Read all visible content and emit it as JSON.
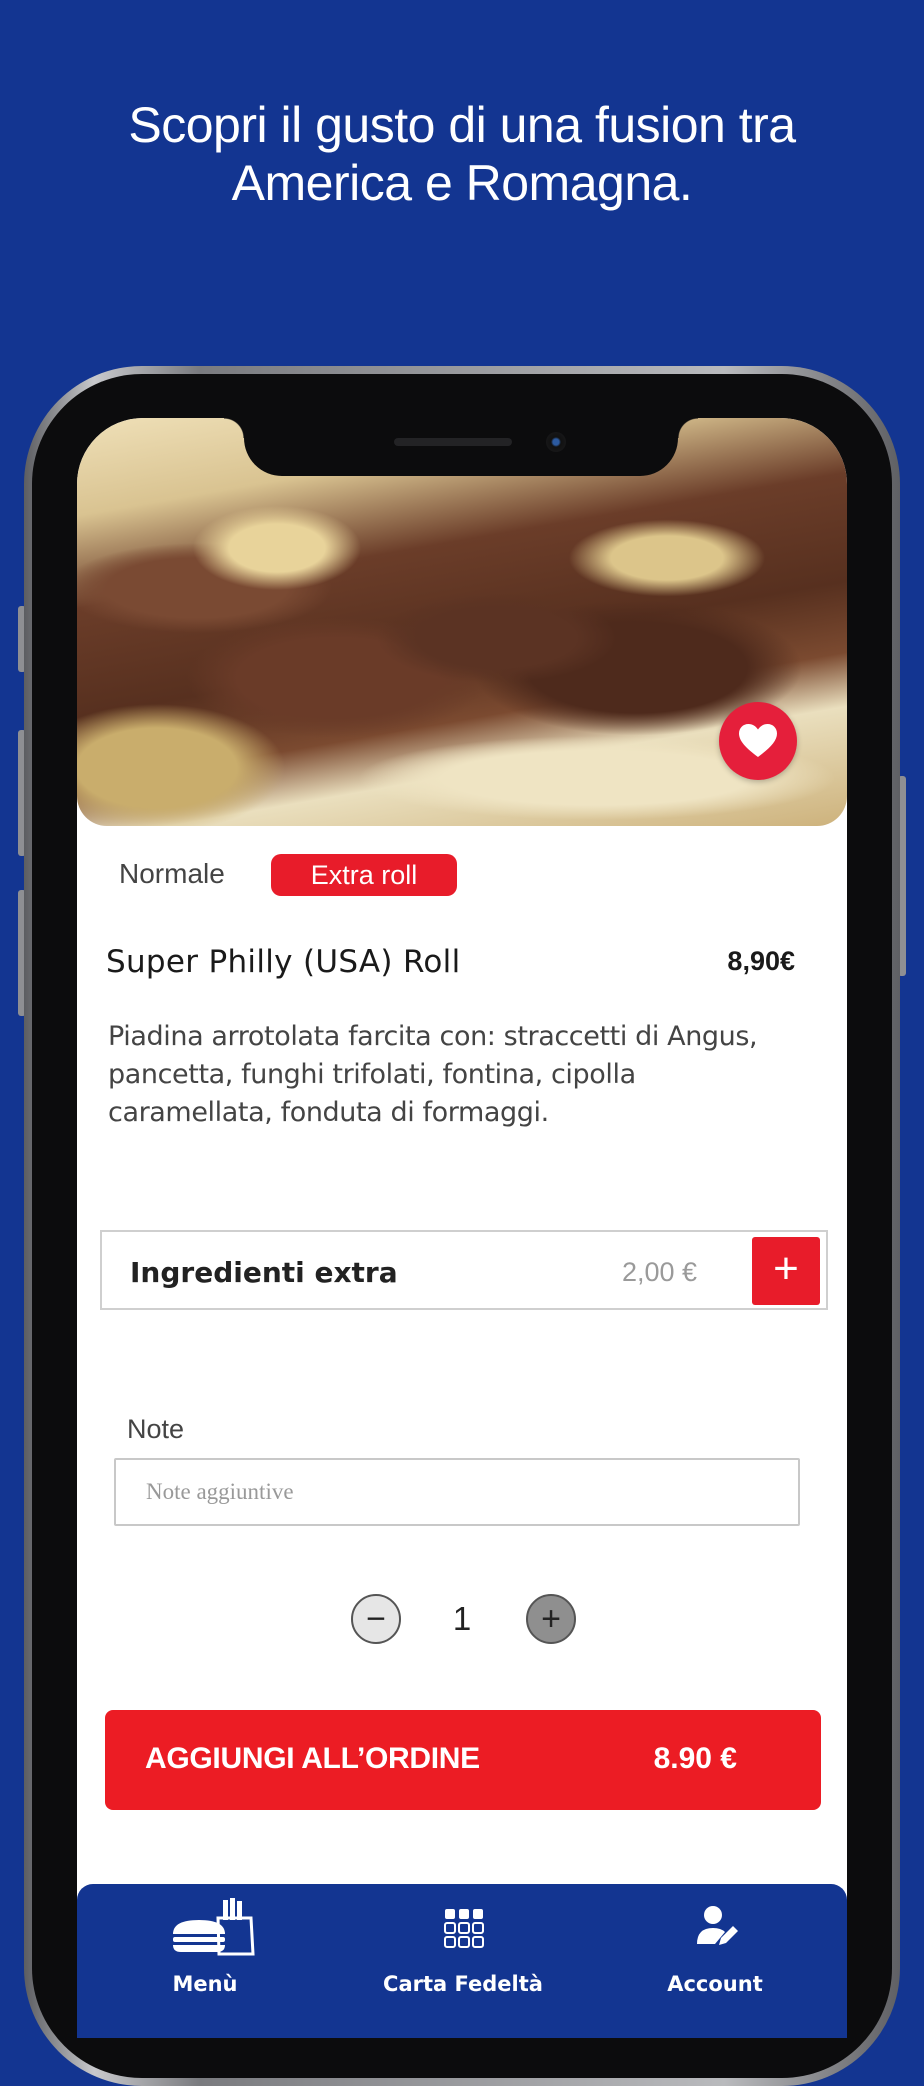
{
  "headline": {
    "line1": "Scopri il gusto di una fusion tra",
    "line2": "America e Romagna."
  },
  "colors": {
    "background": "#133591",
    "accent_red": "#e81c2a",
    "favorite_red": "#e51f3b",
    "tabbar": "#133591"
  },
  "product": {
    "photo": "piadina-roll-photo",
    "sizes": [
      {
        "label": "Normale",
        "selected": false
      },
      {
        "label": "Extra roll",
        "selected": true
      }
    ],
    "name": "Super Philly (USA) Roll",
    "price": "8,90€",
    "description": "Piadina arrotolata farcita con: straccetti di Angus, pancetta, funghi trifolati, fontina, cipolla caramellata, fonduta di formaggi."
  },
  "extras": {
    "label": "Ingredienti extra",
    "price": "2,00 €",
    "add_icon": "+"
  },
  "notes": {
    "label": "Note",
    "placeholder": "Note aggiuntive"
  },
  "quantity": {
    "value": "1",
    "minus_icon": "−",
    "plus_icon": "+"
  },
  "add_to_order": {
    "label": "AGGIUNGI ALL’ORDINE",
    "price": "8.90 €"
  },
  "tabbar": {
    "items": [
      {
        "label": "Menù",
        "icon": "burger-fries-icon"
      },
      {
        "label": "Carta Fedeltà",
        "icon": "grid-icon"
      },
      {
        "label": "Account",
        "icon": "user-edit-icon"
      }
    ]
  }
}
